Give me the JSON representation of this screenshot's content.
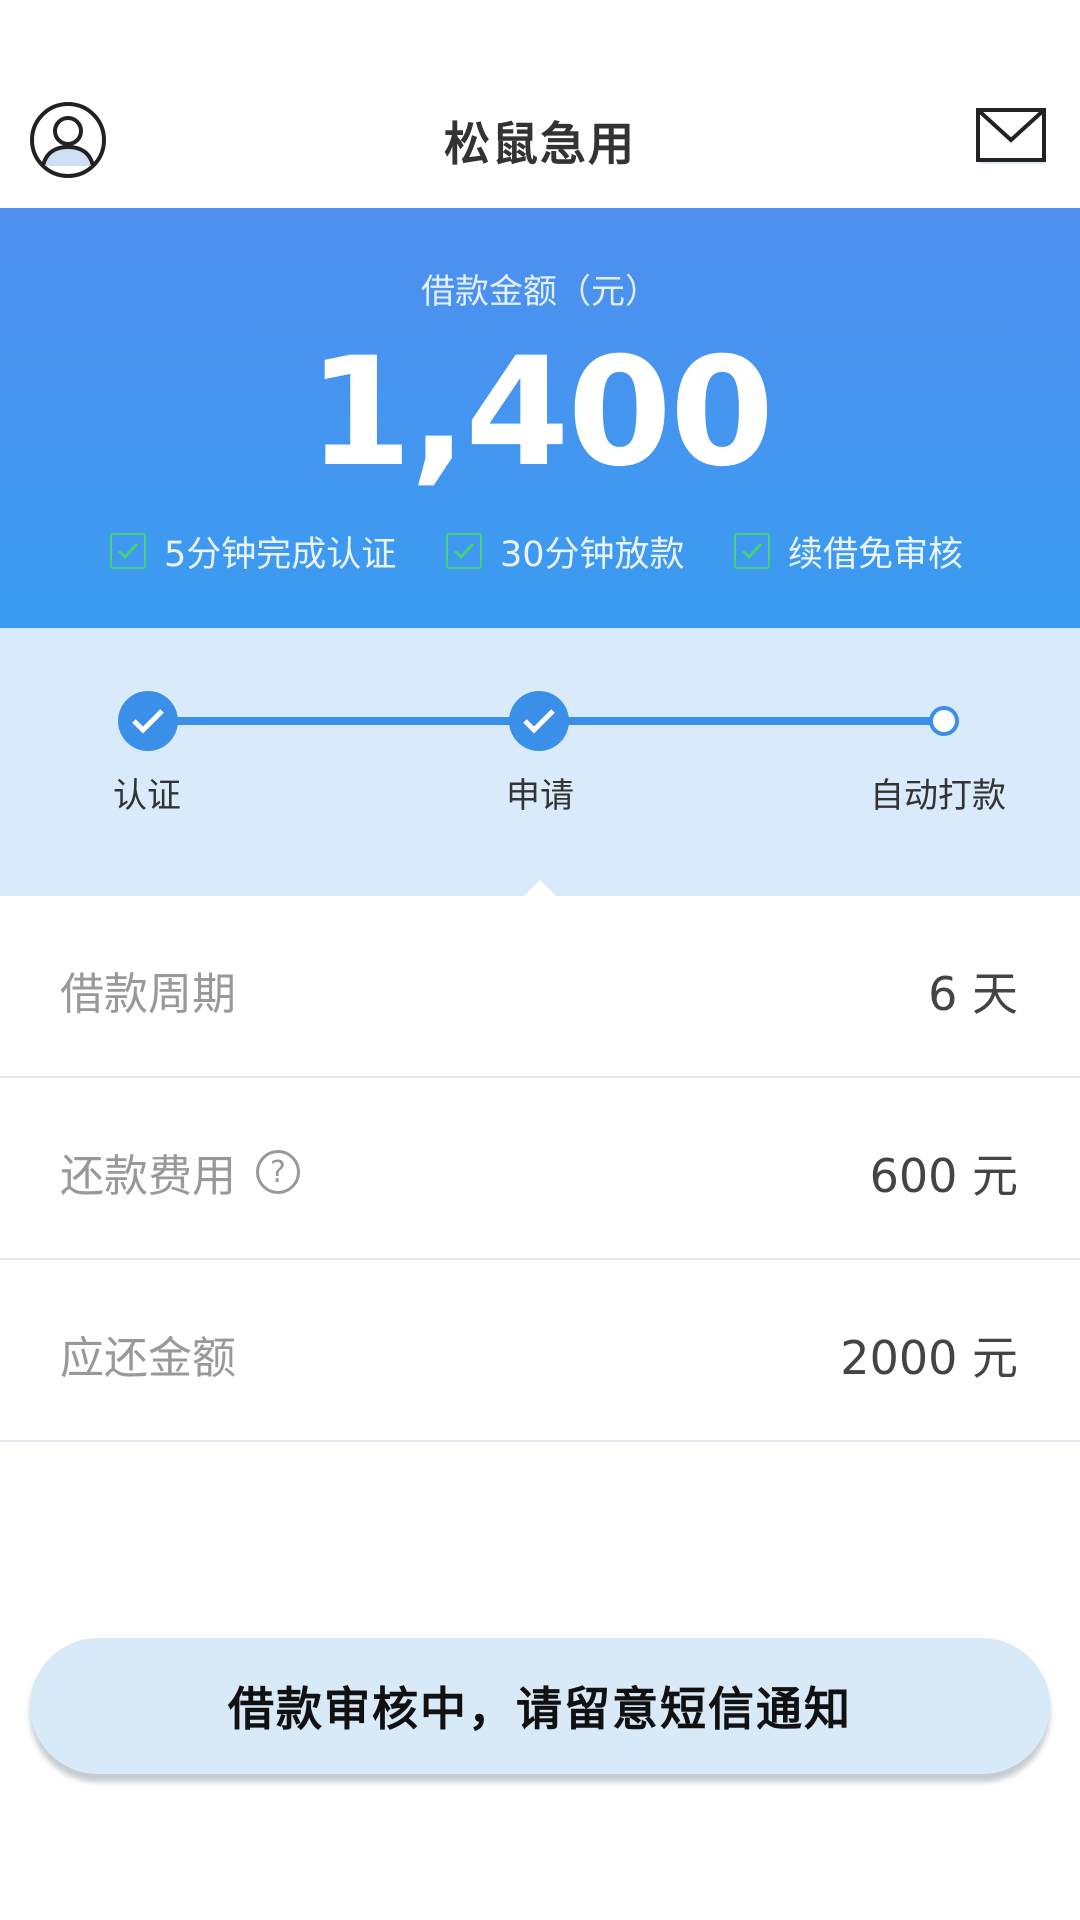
{
  "header": {
    "title": "松鼠急用",
    "profile_icon": "user-circle-icon",
    "mail_icon": "mail-icon"
  },
  "hero": {
    "label": "借款金额（元）",
    "amount": "1,400",
    "features": [
      "5分钟完成认证",
      "30分钟放款",
      "续借免审核"
    ]
  },
  "steps": {
    "items": [
      {
        "label": "认证",
        "done": true
      },
      {
        "label": "申请",
        "done": true
      },
      {
        "label": "自动打款",
        "done": false
      }
    ]
  },
  "details": {
    "period_label": "借款周期",
    "period_value": "6 天",
    "fee_label": "还款费用",
    "fee_value": "600 元",
    "total_label": "应还金额",
    "total_value": "2000 元"
  },
  "status_button": "借款审核中，请留意短信通知",
  "colors": {
    "primary": "#3a90e8",
    "hero_top": "#4f8fef",
    "steps_bg": "#d9ebfa",
    "check_green": "#47d07a"
  }
}
